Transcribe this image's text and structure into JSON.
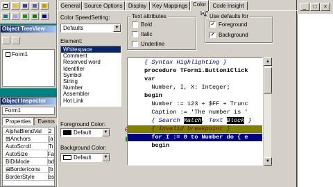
{
  "colors": {
    "desktop": "#008080",
    "selection": "#0a246a",
    "execution_line": "#000080",
    "error_line": "#808000",
    "error_text": "#800000"
  },
  "ide": {
    "object_treeview": {
      "title": "Object TreeView",
      "items": [
        "Form1"
      ]
    },
    "object_inspector": {
      "title": "Object Inspector",
      "selected_object": "Form1",
      "tabs": [
        "Properties",
        "Events"
      ],
      "properties": [
        {
          "name": "AlphaBlendVal",
          "value": "2"
        },
        {
          "name": "⊞Anchors",
          "value": "[a"
        },
        {
          "name": "AutoScroll",
          "value": "Tr"
        },
        {
          "name": "AutoSize",
          "value": "Fa"
        },
        {
          "name": "BiDiMode",
          "value": "bd"
        },
        {
          "name": "⊞BorderIcons",
          "value": "[b"
        },
        {
          "name": "BorderStyle",
          "value": "bs"
        }
      ]
    },
    "window_buttons": [
      "_",
      "□",
      "×"
    ]
  },
  "dialog": {
    "tabs": [
      "General",
      "Source Options",
      "Display",
      "Key Mappings",
      "Color",
      "Code Insight"
    ],
    "active_tab": "Color",
    "color_speedsetting": {
      "label": "Color SpeedSetting:",
      "value": "Defaults"
    },
    "element": {
      "label": "Element:",
      "items": [
        "Whitespace",
        "Comment",
        "Reserved word",
        "Identifier",
        "Symbol",
        "String",
        "Number",
        "Assembler",
        "Hot Link"
      ],
      "selected": "Whitespace"
    },
    "foreground_color": {
      "label": "Foreground Color:",
      "value": "Default"
    },
    "background_color": {
      "label": "Background Color:",
      "value": "Default"
    },
    "text_attributes": {
      "title": "Text attributes",
      "bold": "Bold",
      "italic": "Italic",
      "underline": "Underline"
    },
    "use_defaults": {
      "title": "Use defaults for",
      "foreground": "Foreground",
      "background": "Background"
    },
    "code_preview": {
      "comment": "{ Syntax Highlighting }",
      "line1": "procedure TForm1.Button1Click",
      "line2": "var",
      "line3": "  Number, I, X: Integer;",
      "line4": "begin",
      "line5": "  Number := 123 + $FF + Trunc",
      "line6": "  Caption := 'The number is '",
      "search_pre": "  { Search ",
      "search_match": "Match",
      "search_mid": ", Text ",
      "search_block": "Block",
      "search_post": " }",
      "invalid": "  { Invalid breakpoint }",
      "line9": "  for I := 0 to Number do { e",
      "line10": "  begin"
    }
  }
}
